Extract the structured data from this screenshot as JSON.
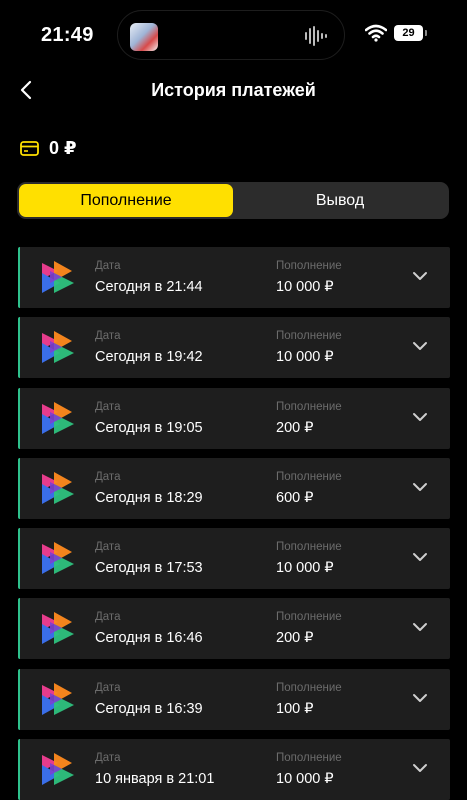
{
  "status_bar": {
    "time": "21:49",
    "battery": "29"
  },
  "header": {
    "title": "История платежей"
  },
  "balance": {
    "value": "0 ₽"
  },
  "tabs": [
    {
      "label": "Пополнение",
      "active": true
    },
    {
      "label": "Вывод",
      "active": false
    }
  ],
  "transactions": [
    {
      "date_label": "Дата",
      "date": "Сегодня в 21:44",
      "amount_label": "Пополнение",
      "amount": "10 000 ₽"
    },
    {
      "date_label": "Дата",
      "date": "Сегодня в 19:42",
      "amount_label": "Пополнение",
      "amount": "10 000 ₽"
    },
    {
      "date_label": "Дата",
      "date": "Сегодня в 19:05",
      "amount_label": "Пополнение",
      "amount": "200 ₽"
    },
    {
      "date_label": "Дата",
      "date": "Сегодня в 18:29",
      "amount_label": "Пополнение",
      "amount": "600 ₽"
    },
    {
      "date_label": "Дата",
      "date": "Сегодня в 17:53",
      "amount_label": "Пополнение",
      "amount": "10 000 ₽"
    },
    {
      "date_label": "Дата",
      "date": "Сегодня в 16:46",
      "amount_label": "Пополнение",
      "amount": "200 ₽"
    },
    {
      "date_label": "Дата",
      "date": "Сегодня в 16:39",
      "amount_label": "Пополнение",
      "amount": "100 ₽"
    },
    {
      "date_label": "Дата",
      "date": "10 января в 21:01",
      "amount_label": "Пополнение",
      "amount": "10 000 ₽"
    }
  ],
  "icons": {
    "back": "chevron-left-icon",
    "balance": "card-icon",
    "row_logo": "logo-icon",
    "row_expand": "chevron-down-icon",
    "wifi": "wifi-icon"
  },
  "colors": {
    "accent": "#ffe000",
    "row_border": "#2fc28d",
    "background": "#000000",
    "card": "#1e1e1e"
  }
}
